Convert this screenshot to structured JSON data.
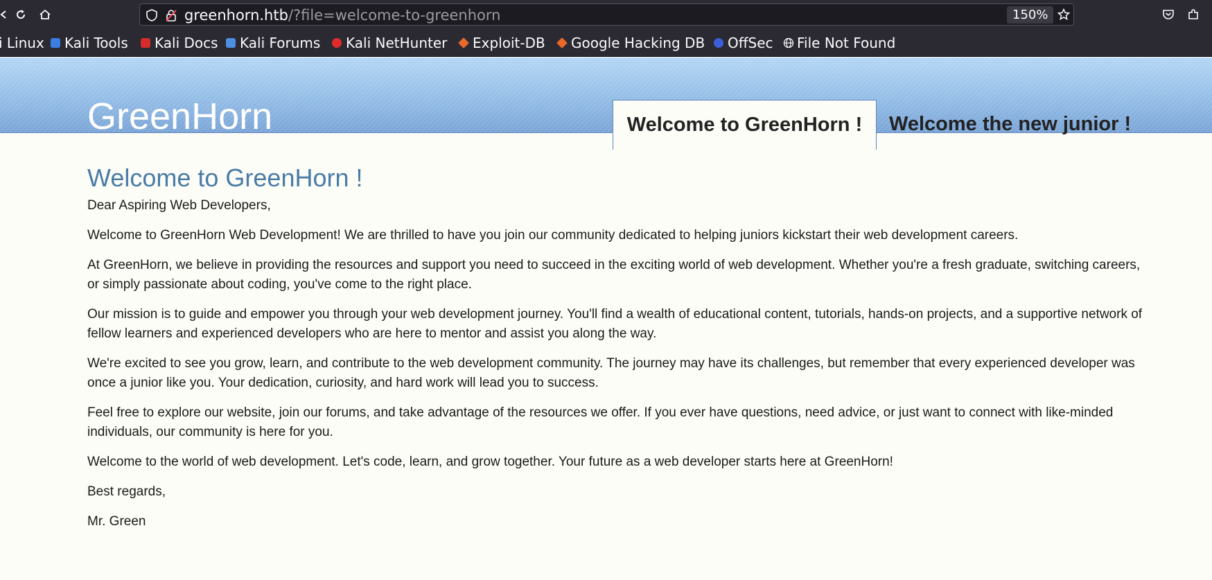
{
  "browser": {
    "url_host": "greenhorn.htb",
    "url_path": "/?file=welcome-to-greenhorn",
    "zoom": "150%",
    "bookmarks": [
      {
        "label": "i Linux",
        "color": ""
      },
      {
        "label": "Kali Tools",
        "color": "#3b7de0"
      },
      {
        "label": "Kali Docs",
        "color": "#d62b2b"
      },
      {
        "label": "Kali Forums",
        "color": "#4d8fe0"
      },
      {
        "label": "Kali NetHunter",
        "color": "#e02b2b"
      },
      {
        "label": "Exploit-DB",
        "color": "#e8692a"
      },
      {
        "label": "Google Hacking DB",
        "color": "#e8692a"
      },
      {
        "label": "OffSec",
        "color": "#3a5fd9"
      },
      {
        "label": "File Not Found",
        "color": ""
      }
    ]
  },
  "site": {
    "title": "GreenHorn",
    "nav_active": "Welcome to GreenHorn !",
    "nav_other": "Welcome the new junior !"
  },
  "content": {
    "heading": "Welcome to GreenHorn !",
    "paragraphs": [
      "Dear Aspiring Web Developers,",
      "Welcome to GreenHorn Web Development! We are thrilled to have you join our community dedicated to helping juniors kickstart their web development careers.",
      "At GreenHorn, we believe in providing the resources and support you need to succeed in the exciting world of web development. Whether you're a fresh graduate, switching careers, or simply passionate about coding, you've come to the right place.",
      "Our mission is to guide and empower you through your web development journey. You'll find a wealth of educational content, tutorials, hands-on projects, and a supportive network of fellow learners and experienced developers who are here to mentor and assist you along the way.",
      "We're excited to see you grow, learn, and contribute to the web development community. The journey may have its challenges, but remember that every experienced developer was once a junior like you. Your dedication, curiosity, and hard work will lead you to success.",
      "Feel free to explore our website, join our forums, and take advantage of the resources we offer. If you ever have questions, need advice, or just want to connect with like-minded individuals, our community is here for you.",
      "Welcome to the world of web development. Let's code, learn, and grow together. Your future as a web developer starts here at GreenHorn!",
      "Best regards,",
      "Mr. Green"
    ]
  }
}
